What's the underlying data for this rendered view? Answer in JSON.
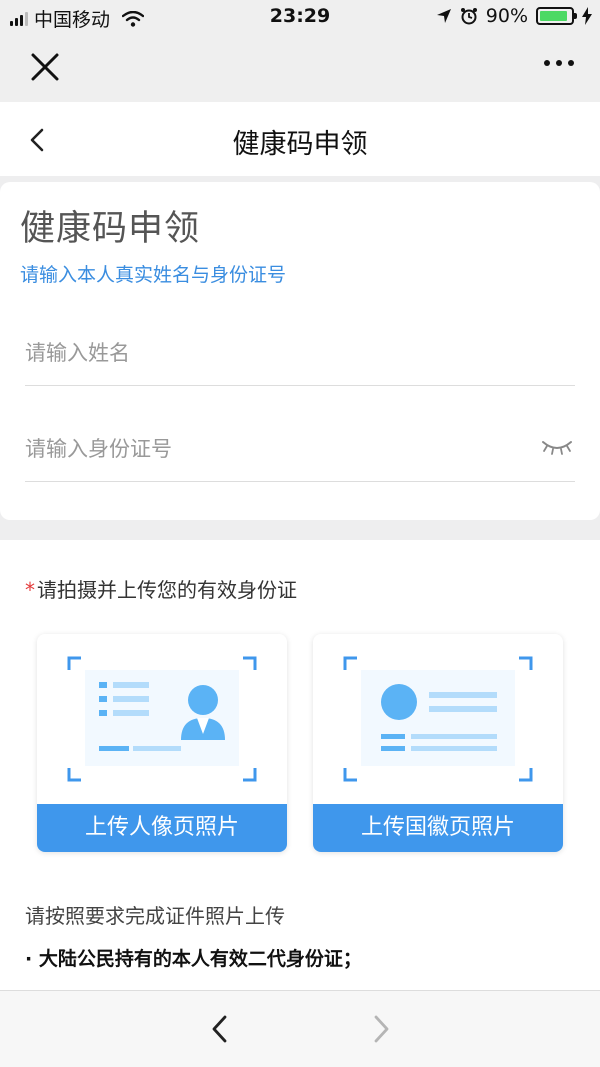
{
  "status_bar": {
    "carrier": "中国移动",
    "time": "23:29",
    "battery": "90%",
    "battery_level": 0.9
  },
  "colors": {
    "accent": "#3a8de0",
    "button": "#3f97ec",
    "required": "#e43b3b",
    "illustration_light": "#b3dcfb",
    "illustration_mid": "#5bb3f5"
  },
  "header": {
    "title": "健康码申领"
  },
  "form": {
    "title": "健康码申领",
    "subtitle": "请输入本人真实姓名与身份证号",
    "name_placeholder": "请输入姓名",
    "id_placeholder": "请输入身份证号"
  },
  "upload": {
    "required_mark": "*",
    "label": "请拍摄并上传您的有效身份证",
    "front_button": "上传人像页照片",
    "back_button": "上传国徽页照片",
    "instructions": "请按照要求完成证件照片上传",
    "rule_1": "· 大陆公民持有的本人有效二代身份证；"
  },
  "icons": [
    "close-icon",
    "more-icon",
    "back-chevron-icon",
    "eye-closed-icon",
    "id-portrait-icon",
    "id-emblem-icon",
    "nav-back-icon",
    "nav-forward-icon"
  ]
}
